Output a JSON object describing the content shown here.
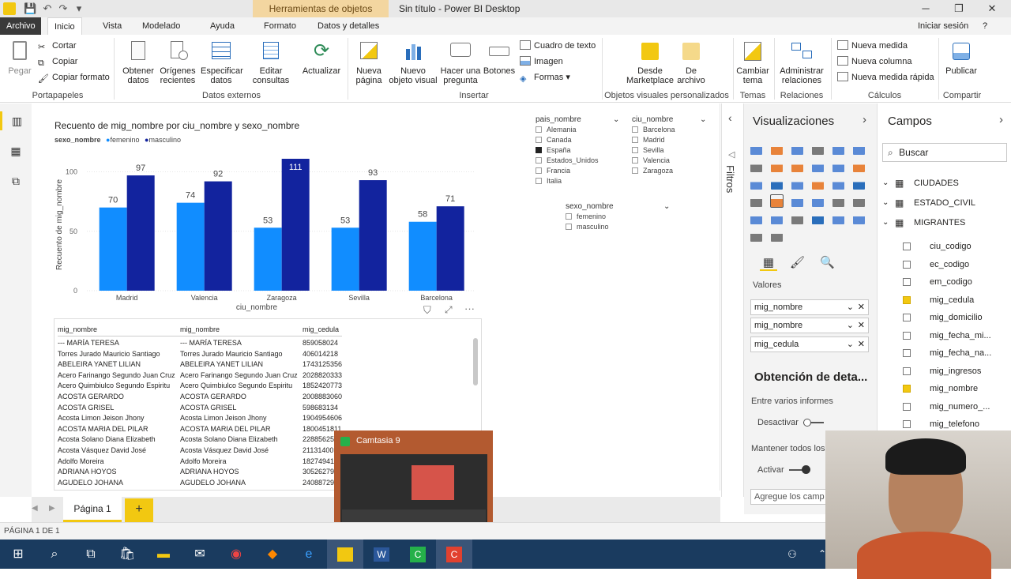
{
  "window": {
    "context_tab": "Herramientas de objetos visuales",
    "title": "Sin título - Power BI Desktop",
    "minimize": "─",
    "maximize": "❐",
    "close": "✕"
  },
  "tabs": {
    "file": "Archivo",
    "items": [
      "Inicio",
      "Vista",
      "Modelado",
      "Ayuda",
      "Formato",
      "Datos y detalles"
    ],
    "signin": "Iniciar sesión",
    "help": "?"
  },
  "ribbon": {
    "paste": "Pegar",
    "cut": "Cortar",
    "copy": "Copiar",
    "copy_format": "Copiar formato",
    "group_clipboard": "Portapapeles",
    "get_data": "Obtener datos",
    "recent_sources": "Orígenes recientes",
    "enter_data": "Especificar datos",
    "edit_queries": "Editar consultas",
    "refresh": "Actualizar",
    "group_external": "Datos externos",
    "new_page": "Nueva página",
    "new_visual": "Nuevo objeto visual",
    "ask_question": "Hacer una pregunta",
    "buttons": "Botones",
    "text_box": "Cuadro de texto",
    "image": "Imagen",
    "shapes": "Formas",
    "group_insert": "Insertar",
    "from_marketplace": "Desde Marketplace",
    "from_file": "De archivo",
    "group_custom_visuals": "Objetos visuales personalizados",
    "switch_theme": "Cambiar tema",
    "group_themes": "Temas",
    "manage_relationships": "Administrar relaciones",
    "group_relationships": "Relaciones",
    "new_measure": "Nueva medida",
    "new_column": "Nueva columna",
    "new_quick_measure": "Nueva medida rápida",
    "group_calculations": "Cálculos",
    "publish": "Publicar",
    "group_share": "Compartir"
  },
  "chart": {
    "title": "Recuento de mig_nombre por ciu_nombre y sexo_nombre",
    "legend_title": "sexo_nombre",
    "legend_items": [
      "femenino",
      "masculino"
    ]
  },
  "chart_data": {
    "type": "bar",
    "title": "Recuento de mig_nombre por ciu_nombre y sexo_nombre",
    "xlabel": "ciu_nombre",
    "ylabel": "Recuento de mig_nombre",
    "categories": [
      "Madrid",
      "Valencia",
      "Zaragoza",
      "Sevilla",
      "Barcelona"
    ],
    "series": [
      {
        "name": "femenino",
        "values": [
          70,
          74,
          53,
          53,
          58
        ],
        "color": "#118dff"
      },
      {
        "name": "masculino",
        "values": [
          97,
          92,
          111,
          93,
          71
        ],
        "color": "#12239e"
      }
    ],
    "yticks": [
      0,
      50,
      100
    ],
    "ylim": [
      0,
      111
    ],
    "legend": "top-left"
  },
  "slicers": {
    "pais": {
      "title": "pais_nombre",
      "items": [
        "Alemania",
        "Canada",
        "España",
        "Estados_Unidos",
        "Francia",
        "Italia"
      ],
      "selected": "España"
    },
    "ciu": {
      "title": "ciu_nombre",
      "items": [
        "Barcelona",
        "Madrid",
        "Sevilla",
        "Valencia",
        "Zaragoza"
      ]
    },
    "sexo": {
      "title": "sexo_nombre",
      "items": [
        "femenino",
        "masculino"
      ]
    }
  },
  "table": {
    "headers": [
      "mig_nombre",
      "mig_nombre",
      "mig_cedula"
    ],
    "rows": [
      [
        "--- MARÍA TERESA",
        "--- MARÍA TERESA",
        "859058024"
      ],
      [
        "Torres Jurado Mauricio Santiago",
        "Torres Jurado Mauricio Santiago",
        "406014218"
      ],
      [
        "ABELEIRA YANET LILIAN",
        "ABELEIRA YANET LILIAN",
        "1743125356"
      ],
      [
        "Acero Farinango Segundo Juan Cruz",
        "Acero Farinango Segundo Juan Cruz",
        "2028820333"
      ],
      [
        "Acero Quimbiulco Segundo Espiritu",
        "Acero Quimbiulco Segundo Espiritu",
        "1852420773"
      ],
      [
        "ACOSTA GERARDO",
        "ACOSTA GERARDO",
        "2008883060"
      ],
      [
        "ACOSTA GRISEL",
        "ACOSTA GRISEL",
        "598683134"
      ],
      [
        "Acosta Limon Jeison Jhony",
        "Acosta Limon Jeison Jhony",
        "1904954606"
      ],
      [
        "ACOSTA MARIA DEL PILAR",
        "ACOSTA MARIA DEL PILAR",
        "1800451811"
      ],
      [
        "Acosta Solano Diana Elizabeth",
        "Acosta Solano Diana Elizabeth",
        "22885625"
      ],
      [
        "Acosta Vásquez David José",
        "Acosta Vásquez David José",
        "21131400"
      ],
      [
        "Adolfo Moreira",
        "Adolfo Moreira",
        "18274941"
      ],
      [
        "ADRIANA HOYOS",
        "ADRIANA HOYOS",
        "30526279"
      ],
      [
        "AGUDELO JOHANA",
        "AGUDELO JOHANA",
        "24088729"
      ]
    ]
  },
  "filters_label": "Filtros",
  "viz_pane": {
    "title": "Visualizaciones",
    "values_label": "Valores",
    "value_fields": [
      "mig_nombre",
      "mig_nombre",
      "mig_cedula"
    ],
    "drill_title": "Obtención de deta...",
    "cross_report": "Entre varios informes",
    "off_label": "Desactivar",
    "keep_all": "Mantener todos los",
    "on_label": "Activar",
    "add_fields": "Agregue los camp"
  },
  "fields_pane": {
    "title": "Campos",
    "search_placeholder": "Buscar",
    "tables": [
      "CIUDADES",
      "ESTADO_CIVIL",
      "MIGRANTES"
    ],
    "fields": [
      {
        "name": "ciu_codigo",
        "checked": false
      },
      {
        "name": "ec_codigo",
        "checked": false
      },
      {
        "name": "em_codigo",
        "checked": false
      },
      {
        "name": "mig_cedula",
        "checked": true
      },
      {
        "name": "mig_domicilio",
        "checked": false
      },
      {
        "name": "mig_fecha_mi...",
        "checked": false
      },
      {
        "name": "mig_fecha_na...",
        "checked": false
      },
      {
        "name": "mig_ingresos",
        "checked": false
      },
      {
        "name": "mig_nombre",
        "checked": true
      },
      {
        "name": "mig_numero_...",
        "checked": false
      },
      {
        "name": "mig_telefono",
        "checked": false
      }
    ]
  },
  "pages": {
    "tab": "Página 1",
    "add": "+"
  },
  "status": "PÁGINA 1 DE 1",
  "camtasia": {
    "label": "Camtasia 9"
  },
  "colors": {
    "femenino": "#118dff",
    "masculino": "#12239e",
    "accent": "#f2c811",
    "taskbar": "#1a3b5f"
  }
}
